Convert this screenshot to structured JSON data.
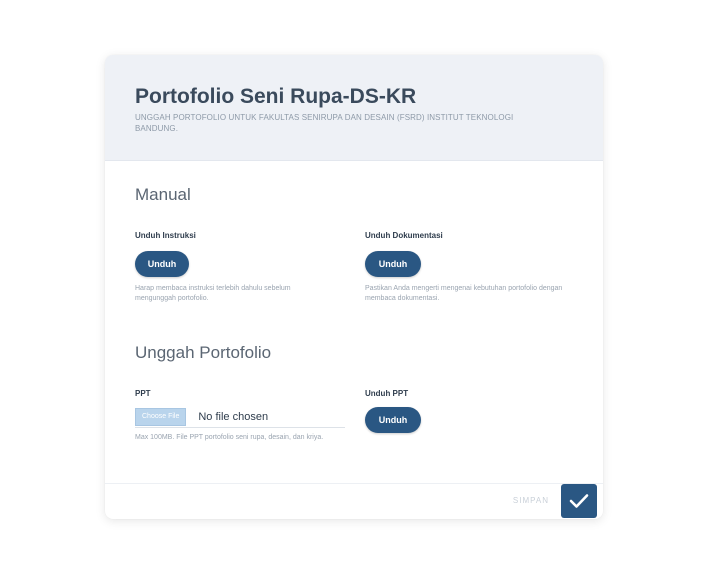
{
  "header": {
    "title": "Portofolio Seni Rupa-DS-KR",
    "subtitle": "Unggah portofolio untuk FAKULTAS SENIRUPA DAN DESAIN (FSRD) INSTITUT TEKNOLOGI BANDUNG."
  },
  "manual": {
    "heading": "Manual",
    "instruction": {
      "label": "Unduh Instruksi",
      "button": "Unduh",
      "help": "Harap membaca instruksi terlebih dahulu sebelum mengunggah portofolio."
    },
    "documentation": {
      "label": "Unduh Dokumentasi",
      "button": "Unduh",
      "help": "Pastikan Anda mengerti mengenai kebutuhan portofolio dengan membaca dokumentasi."
    }
  },
  "upload": {
    "heading": "Unggah Portofolio",
    "ppt": {
      "label": "PPT",
      "choose_button": "Choose File",
      "file_status": "No file chosen",
      "help": "Max 100MB. File PPT portofolio seni rupa, desain, dan kriya."
    },
    "download_ppt": {
      "label": "Unduh PPT",
      "button": "Unduh"
    }
  },
  "footer": {
    "save_label": "SIMPAN",
    "confirm_icon": "check-icon"
  },
  "colors": {
    "accent": "#2a5783",
    "header_bg": "#eef1f6",
    "choose_file_bg": "#b9d4ec"
  }
}
